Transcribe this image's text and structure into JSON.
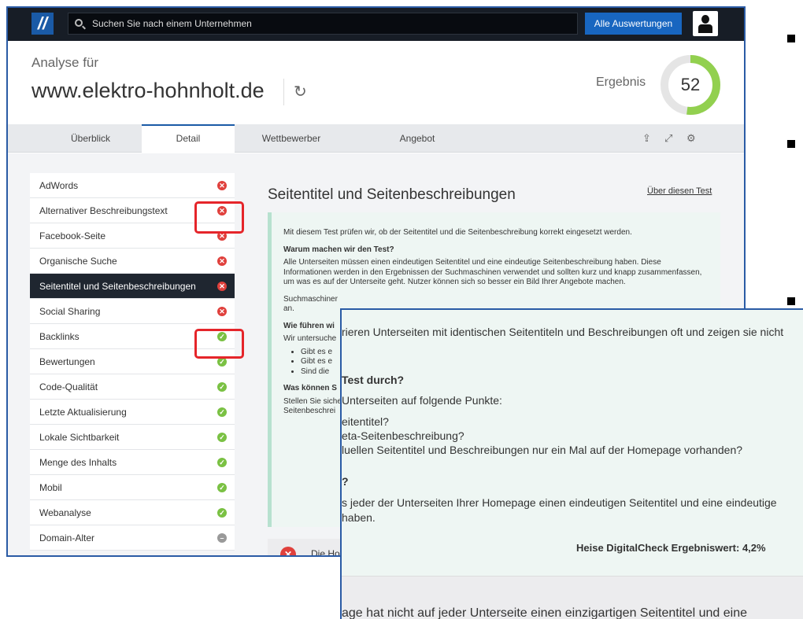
{
  "search_placeholder": "Suchen Sie nach einem Unternehmen",
  "all_button": "Alle Auswertungen",
  "analyse_label": "Analyse für",
  "domain": "www.elektro-hohnholt.de",
  "result_label": "Ergebnis",
  "score": 52,
  "tabs": [
    "Überblick",
    "Detail",
    "Wettbewerber",
    "Angebot"
  ],
  "sidebar": [
    {
      "label": "AdWords",
      "status": "fail"
    },
    {
      "label": "Alternativer Beschreibungstext",
      "status": "fail"
    },
    {
      "label": "Facebook-Seite",
      "status": "fail"
    },
    {
      "label": "Organische Suche",
      "status": "fail"
    },
    {
      "label": "Seitentitel und Seitenbeschreibungen",
      "status": "fail"
    },
    {
      "label": "Social Sharing",
      "status": "fail"
    },
    {
      "label": "Backlinks",
      "status": "ok"
    },
    {
      "label": "Bewertungen",
      "status": "ok"
    },
    {
      "label": "Code-Qualität",
      "status": "ok"
    },
    {
      "label": "Letzte Aktualisierung",
      "status": "ok"
    },
    {
      "label": "Lokale Sichtbarkeit",
      "status": "ok"
    },
    {
      "label": "Menge des Inhalts",
      "status": "ok"
    },
    {
      "label": "Mobil",
      "status": "ok"
    },
    {
      "label": "Webanalyse",
      "status": "ok"
    },
    {
      "label": "Domain-Alter",
      "status": "na"
    }
  ],
  "content": {
    "title": "Seitentitel und Seitenbeschreibungen",
    "about_link": "Über diesen Test",
    "intro": "Mit diesem Test prüfen wir, ob der Seitentitel und die Seitenbeschreibung korrekt eingesetzt werden.",
    "why_heading": "Warum machen wir den Test?",
    "why_text": "Alle Unterseiten müssen einen eindeutigen Seitentitel und eine eindeutige Seitenbeschreibung haben. Diese Informationen werden in den Ergebnissen der Suchmaschinen verwendet und sollten kurz und knapp zusammenfassen, um was es auf der Unterseite geht. Nutzer können sich so besser ein Bild Ihrer Angebote machen.",
    "why_text2": "Suchmaschiner",
    "why_text2b": "an.",
    "how_heading": "Wie führen wi",
    "how_text": "Wir untersuche",
    "bullets": [
      "Gibt es e",
      "Gibt es e",
      "Sind die"
    ],
    "can_heading": "Was können S",
    "can_text1": "Stellen Sie siche",
    "can_text2": "Seitenbeschrei",
    "result_text": "Die Ho"
  },
  "zoom": {
    "line1": "rieren Unterseiten mit identischen Seitentiteln und Beschreibungen oft und zeigen sie nicht",
    "heading": "Test durch?",
    "line2": "Unterseiten auf folgende Punkte:",
    "b1": "eitentitel?",
    "b2": "eta-Seitenbeschreibung?",
    "b3": "luellen Seitentitel und Beschreibungen nur ein Mal auf der Homepage vorhanden?",
    "q": "?",
    "line3": "s jeder der Unterseiten Ihrer Homepage einen eindeutigen Seitentitel und eine eindeutige",
    "line4": "haben.",
    "score_line": "Heise DigitalCheck Ergebniswert: 4,2%",
    "footer_text": "age hat nicht auf jeder Unterseite einen einzigartigen Seitentitel und eine"
  },
  "colors": {
    "accent": "#1866c0",
    "fail": "#e0403c",
    "ok": "#7ac143",
    "highlight": "#e5252a"
  }
}
